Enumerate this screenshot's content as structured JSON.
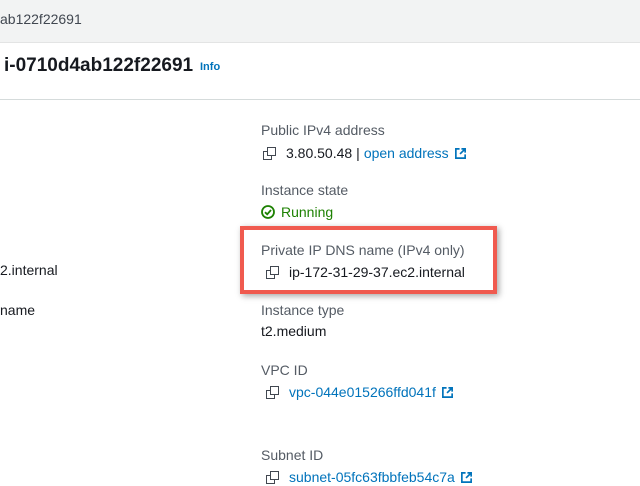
{
  "topbar": {
    "breadcrumb_text": "ab122f22691"
  },
  "header": {
    "title": "i-0710d4ab122f22691",
    "info_label": "Info"
  },
  "left_column": {
    "private_dns_value_partial": "2.internal",
    "label_partial": "name"
  },
  "details": {
    "public_ipv4": {
      "label": "Public IPv4 address",
      "value": "3.80.50.48",
      "separator": "|",
      "link_text": "open address"
    },
    "instance_state": {
      "label": "Instance state",
      "value": "Running"
    },
    "private_ip_dns": {
      "label": "Private IP DNS name (IPv4 only)",
      "value": "ip-172-31-29-37.ec2.internal"
    },
    "instance_type": {
      "label": "Instance type",
      "value": "t2.medium"
    },
    "vpc_id": {
      "label": "VPC ID",
      "value": "vpc-044e015266ffd041f"
    },
    "subnet_id": {
      "label": "Subnet ID",
      "value": "subnet-05fc63fbbfeb54c7a"
    }
  },
  "colors": {
    "link": "#0073bb",
    "success": "#1d8102",
    "highlight": "#f05a4f"
  },
  "icons": {
    "copy": "copy-icon",
    "external": "external-link-icon",
    "status": "check-circle-icon"
  }
}
